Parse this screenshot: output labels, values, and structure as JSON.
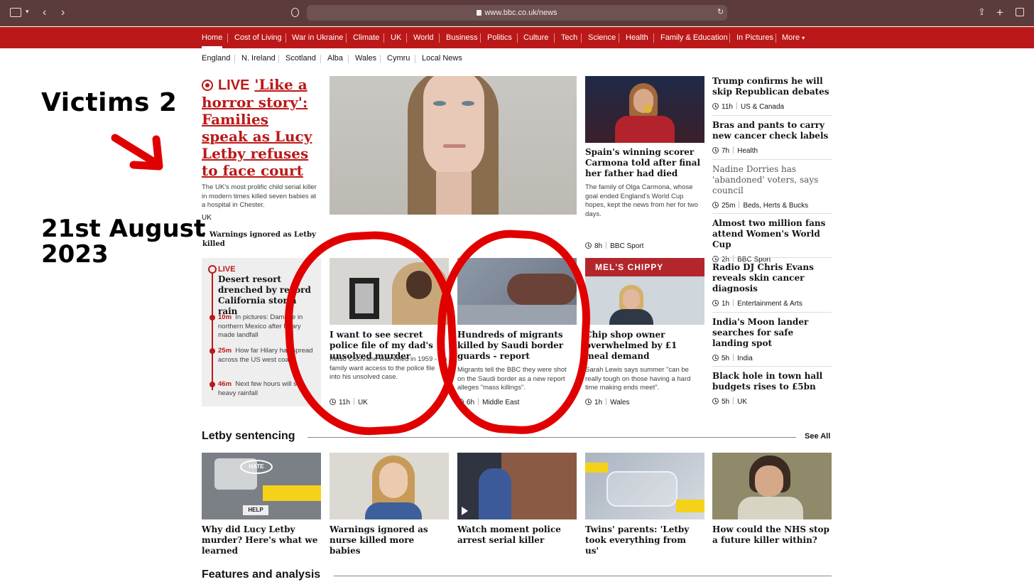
{
  "browser": {
    "url": "www.bbc.co.uk/news"
  },
  "nav": {
    "items": [
      "Home",
      "Cost of Living",
      "War in Ukraine",
      "Climate",
      "UK",
      "World",
      "Business",
      "Politics",
      "Culture",
      "Tech",
      "Science",
      "Health",
      "Family & Education",
      "In Pictures",
      "More"
    ],
    "active": "Home"
  },
  "subnav": [
    "England",
    "N. Ireland",
    "Scotland",
    "Alba",
    "Wales",
    "Cymru",
    "Local News"
  ],
  "annotation": {
    "line1": "Victims 2",
    "date_line1": "21st August",
    "date_line2": "2023",
    "marker_color": "#e00000"
  },
  "lead": {
    "live_label": "LIVE",
    "headline": "'Like a horror story': Families speak as Lucy Letby refuses to face court",
    "summary": "The UK's most prolific child serial killer in modern times killed seven babies at a hospital in Chester.",
    "tag": "UK",
    "bullet": "Warnings ignored as Letby killed"
  },
  "live_box": {
    "label": "LIVE",
    "headline": "Desert resort drenched by record California storm rain",
    "updates": [
      {
        "time": "10m",
        "text": "In pictures: Damage in northern Mexico after Hilary made landfall"
      },
      {
        "time": "25m",
        "text": "How far Hilary has spread across the US west coast"
      },
      {
        "time": "46m",
        "text": "Next few hours will see heavy rainfall"
      }
    ]
  },
  "spain": {
    "headline": "Spain's winning scorer Carmona told after final her father had died",
    "summary": "The family of Olga Carmona, whose goal ended England's World Cup hopes, kept the news from her for two days.",
    "time": "8h",
    "tag": "BBC Sport"
  },
  "stories": [
    {
      "headline": "I want to see secret police file of my dad's unsolved murder",
      "summary": "Kelso Cochrane was killed in 1959 - his family want access to the police file into his unsolved case.",
      "time": "11h",
      "tag": "UK"
    },
    {
      "headline": "Hundreds of migrants killed by Saudi border guards - report",
      "summary": "Migrants tell the BBC they were shot on the Saudi border as a new report alleges \"mass killings\".",
      "time": "6h",
      "tag": "Middle East"
    },
    {
      "headline": "Chip shop owner overwhelmed by £1 meal demand",
      "summary": "Sarah Lewis says summer \"can be really tough on those having a hard time making ends meet\".",
      "time": "1h",
      "tag": "Wales"
    }
  ],
  "chippy_sign": "MEL'S CHIPPY",
  "sidebar": [
    {
      "headline": "Trump confirms he will skip Republican debates",
      "time": "11h",
      "tag": "US & Canada",
      "muted": false
    },
    {
      "headline": "Bras and pants to carry new cancer check labels",
      "time": "7h",
      "tag": "Health",
      "muted": false
    },
    {
      "headline": "Nadine Dorries has 'abandoned' voters, says council",
      "time": "25m",
      "tag": "Beds, Herts & Bucks",
      "muted": true
    },
    {
      "headline": "Almost two million fans attend Women's World Cup",
      "time": "2h",
      "tag": "BBC Sport",
      "muted": false
    },
    {
      "headline": "Radio DJ Chris Evans reveals skin cancer diagnosis",
      "time": "1h",
      "tag": "Entertainment & Arts",
      "muted": false
    },
    {
      "headline": "India's Moon lander searches for safe landing spot",
      "time": "5h",
      "tag": "India",
      "muted": false
    },
    {
      "headline": "Black hole in town hall budgets rises to £5bn",
      "time": "5h",
      "tag": "UK",
      "muted": false
    }
  ],
  "letby_section": {
    "title": "Letby sentencing",
    "see_all": "See All",
    "items": [
      {
        "headline": "Why did Lucy Letby murder? Here's what we learned"
      },
      {
        "headline": "Warnings ignored as nurse killed more babies"
      },
      {
        "headline": "Watch moment police arrest serial killer"
      },
      {
        "headline": "Twins' parents: 'Letby took everything from us'"
      },
      {
        "headline": "How could the NHS stop a future killer within?"
      }
    ],
    "img1_text_hate": "HATE",
    "img1_text_help": "HELP"
  },
  "features": {
    "title": "Features and analysis"
  }
}
